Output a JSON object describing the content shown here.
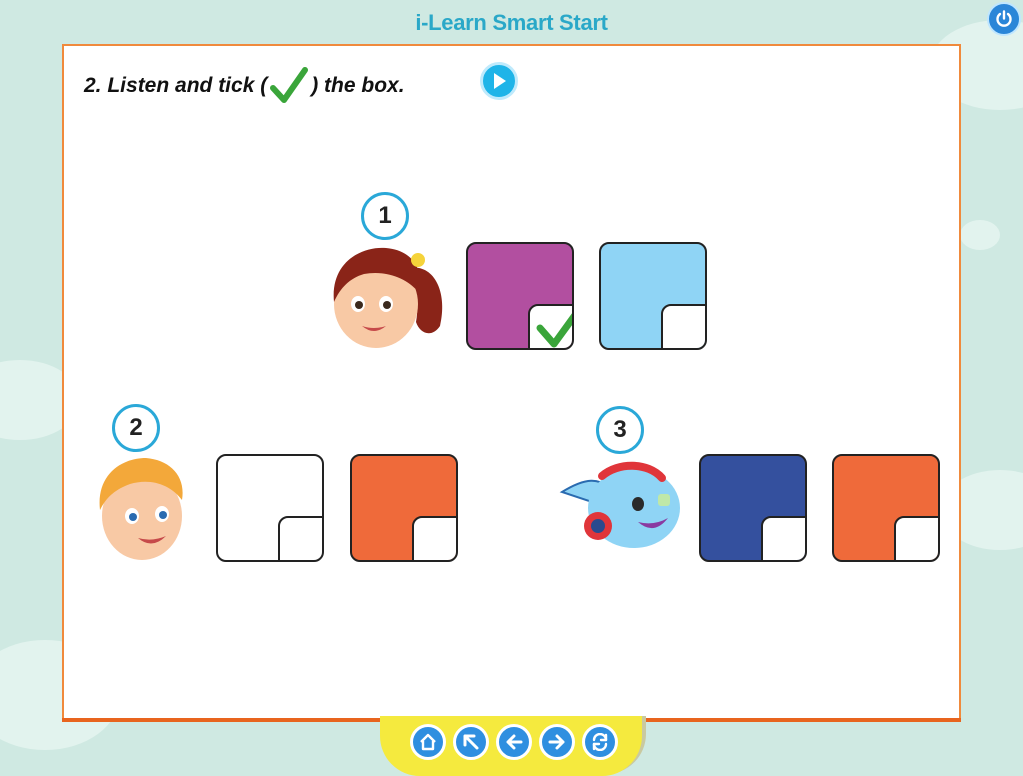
{
  "app": {
    "title": "i-Learn Smart Start"
  },
  "exercise": {
    "instruction_prefix": "2. Listen and tick (",
    "instruction_suffix": ") the box.",
    "tick_icon": "checkmark-icon",
    "play_icon": "play-icon"
  },
  "items": [
    {
      "number": "1",
      "character": "girl-face",
      "boxes": [
        {
          "color": "#b24fa0",
          "checked": true
        },
        {
          "color": "#8fd4f5",
          "checked": false
        }
      ]
    },
    {
      "number": "2",
      "character": "boy-face",
      "boxes": [
        {
          "color": "#ffffff",
          "checked": false
        },
        {
          "color": "#ef6a3a",
          "checked": false
        }
      ]
    },
    {
      "number": "3",
      "character": "robot-face",
      "boxes": [
        {
          "color": "#34509e",
          "checked": false
        },
        {
          "color": "#ef6a3a",
          "checked": false
        }
      ]
    }
  ],
  "nav": {
    "buttons": [
      "home-icon",
      "arrow-up-left-icon",
      "arrow-left-icon",
      "arrow-right-icon",
      "refresh-icon"
    ]
  },
  "colors": {
    "accent": "#2aa8c8",
    "panel_border": "#f08a3c",
    "nav_bar": "#f5ea3e",
    "tick": "#3aa53a"
  }
}
